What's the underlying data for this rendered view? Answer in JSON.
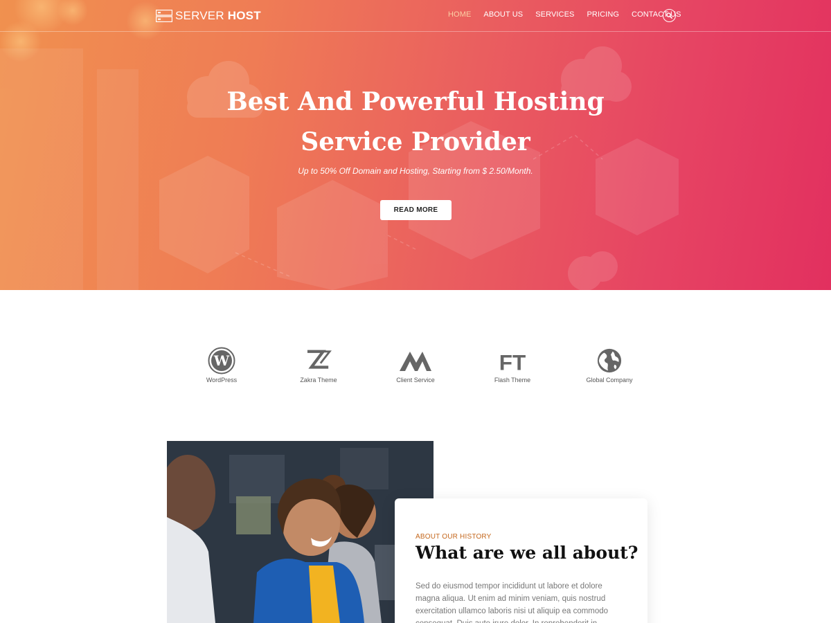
{
  "header": {
    "logo": {
      "light": "SERVER",
      "bold": "HOST"
    },
    "nav": [
      {
        "label": "HOME",
        "active": true
      },
      {
        "label": "ABOUT US",
        "active": false
      },
      {
        "label": "SERVICES",
        "active": false
      },
      {
        "label": "PRICING",
        "active": false
      },
      {
        "label": "CONTACT US",
        "active": false
      }
    ],
    "search_icon": "search-icon"
  },
  "hero": {
    "title_line1": "Best And Powerful Hosting",
    "title_line2": "Service Provider",
    "subtitle": "Up to 50% Off Domain and Hosting, Starting from $ 2.50/Month.",
    "button": "READ MORE"
  },
  "clients": [
    {
      "label": "WordPress",
      "icon": "wordpress-icon"
    },
    {
      "label": "Zakra Theme",
      "icon": "zakra-logo-icon"
    },
    {
      "label": "Client Service",
      "icon": "mountain-logo-icon"
    },
    {
      "label": "Flash Theme",
      "icon": "ft-logo-icon"
    },
    {
      "label": "Global Company",
      "icon": "globe-icon"
    }
  ],
  "about": {
    "eyebrow": "ABOUT OUR HISTORY",
    "title": "What are we all about?",
    "text": "Sed do eiusmod tempor incididunt ut labore et dolore magna aliqua. Ut enim ad minim veniam, quis nostrud exercitation ullamco laboris nisi ut aliquip ea commodo consequat. Duis aute irure dolor. In reprehenderit in voluptate velit esse cillum"
  },
  "colors": {
    "hero_gradient_start": "#f0914f",
    "hero_gradient_end": "#e2305f",
    "accent": "#c4671c",
    "nav_active": "#fbd0a5"
  }
}
